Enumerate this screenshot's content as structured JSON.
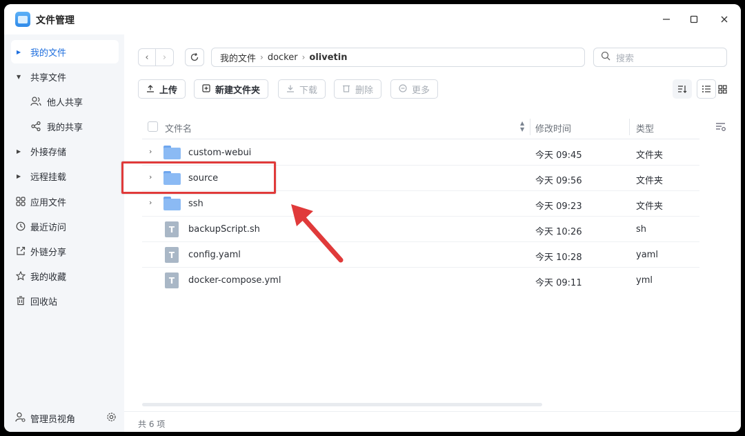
{
  "window": {
    "title": "文件管理",
    "minimize_icon": "minimize-icon",
    "maximize_icon": "maximize-icon",
    "close_icon": "close-icon"
  },
  "sidebar": {
    "items": [
      {
        "label": "我的文件",
        "icon": "caret-right",
        "active": true
      },
      {
        "label": "共享文件",
        "icon": "caret-down"
      },
      {
        "label": "他人共享",
        "icon": "users-icon"
      },
      {
        "label": "我的共享",
        "icon": "share-icon"
      },
      {
        "label": "外接存储",
        "icon": "caret-right"
      },
      {
        "label": "远程挂载",
        "icon": "caret-right"
      },
      {
        "label": "应用文件",
        "icon": "grid-icon"
      },
      {
        "label": "最近访问",
        "icon": "clock-icon"
      },
      {
        "label": "外链分享",
        "icon": "external-link-icon"
      },
      {
        "label": "我的收藏",
        "icon": "star-icon"
      },
      {
        "label": "回收站",
        "icon": "trash-icon"
      }
    ],
    "bottom": {
      "label": "管理员视角",
      "icon": "admin-icon",
      "settings_icon": "gear-icon"
    }
  },
  "breadcrumb": [
    "我的文件",
    "docker",
    "olivetin"
  ],
  "search": {
    "placeholder": "搜索"
  },
  "toolbar": {
    "upload": "上传",
    "new_folder": "新建文件夹",
    "download": "下载",
    "delete": "删除",
    "more": "更多"
  },
  "table": {
    "columns": {
      "name": "文件名",
      "modified": "修改时间",
      "type": "类型"
    },
    "rows": [
      {
        "name": "custom-webui",
        "modified": "今天 09:45",
        "type": "文件夹",
        "kind": "folder"
      },
      {
        "name": "source",
        "modified": "今天 09:56",
        "type": "文件夹",
        "kind": "folder"
      },
      {
        "name": "ssh",
        "modified": "今天 09:23",
        "type": "文件夹",
        "kind": "folder"
      },
      {
        "name": "backupScript.sh",
        "modified": "今天 10:26",
        "type": "sh",
        "kind": "file"
      },
      {
        "name": "config.yaml",
        "modified": "今天 10:28",
        "type": "yaml",
        "kind": "file"
      },
      {
        "name": "docker-compose.yml",
        "modified": "今天 09:11",
        "type": "yml",
        "kind": "file"
      }
    ]
  },
  "footer": {
    "count_text": "共 6 项"
  },
  "file_glyph": "T",
  "annotation": {
    "color": "#e03a3a"
  }
}
